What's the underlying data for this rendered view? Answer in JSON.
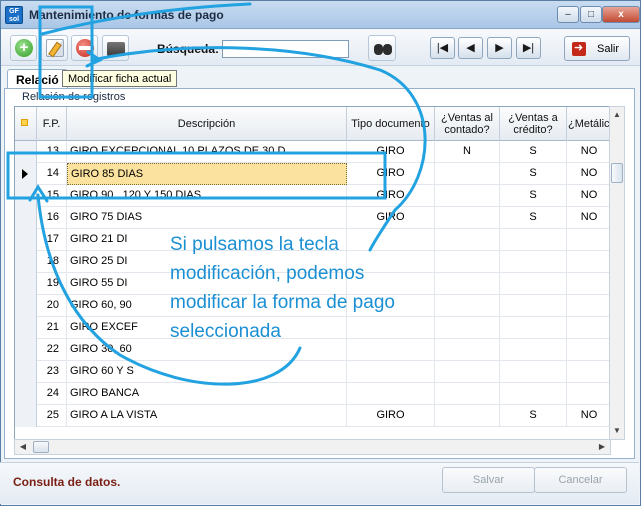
{
  "window": {
    "app_icon": "GF sol",
    "title": "Mantenimiento de formas de pago",
    "controls": {
      "minimize": "–",
      "maximize": "□",
      "close": "x"
    }
  },
  "toolbar": {
    "buttons": [
      {
        "name": "add",
        "icon": "add-icon"
      },
      {
        "name": "edit",
        "icon": "edit-icon"
      },
      {
        "name": "delete",
        "icon": "delete-icon"
      },
      {
        "name": "print",
        "icon": "print-icon"
      }
    ],
    "search_label": "Búsqueda:",
    "search_value": "",
    "search_icon": "binoculars-icon",
    "nav": {
      "first": "|◀",
      "prev": "◀",
      "next": "▶",
      "last": "▶|"
    },
    "exit_label": "Salir"
  },
  "tooltip": "Modificar ficha actual",
  "tab": {
    "label": "Relació"
  },
  "group_label": "Relación de registros",
  "table": {
    "columns": [
      "F.P.",
      "Descripción",
      "Tipo documento",
      "¿Ventas al contado?",
      "¿Ventas a crédito?",
      "¿Metálico?"
    ],
    "header_marker_icon": "select-all-icon",
    "selected_row_index": 1,
    "rows": [
      {
        "fp": "13",
        "desc": "GIRO EXCEPCIONAL 10 PLAZOS DE 30 D",
        "tipo": "GIRO",
        "contado": "N",
        "credito": "S",
        "metalico": "NO"
      },
      {
        "fp": "14",
        "desc": "GIRO  85 DIAS",
        "tipo": "GIRO",
        "contado": "",
        "credito": "S",
        "metalico": "NO"
      },
      {
        "fp": "15",
        "desc": "GIRO 90 , 120 Y 150 DIAS",
        "tipo": "GIRO",
        "contado": "",
        "credito": "S",
        "metalico": "NO"
      },
      {
        "fp": "16",
        "desc": "GIRO  75 DIAS",
        "tipo": "GIRO",
        "contado": "",
        "credito": "S",
        "metalico": "NO"
      },
      {
        "fp": "17",
        "desc": "GIRO  21 DI",
        "tipo": "",
        "contado": "",
        "credito": "",
        "metalico": ""
      },
      {
        "fp": "18",
        "desc": "GIRO  25 DI",
        "tipo": "",
        "contado": "",
        "credito": "",
        "metalico": ""
      },
      {
        "fp": "19",
        "desc": "GIRO  55 DI",
        "tipo": "",
        "contado": "",
        "credito": "",
        "metalico": ""
      },
      {
        "fp": "20",
        "desc": "GIRO 60, 90",
        "tipo": "",
        "contado": "",
        "credito": "",
        "metalico": ""
      },
      {
        "fp": "21",
        "desc": "GIRO EXCEF",
        "tipo": "",
        "contado": "",
        "credito": "",
        "metalico": ""
      },
      {
        "fp": "22",
        "desc": "GIRO 30, 60",
        "tipo": "",
        "contado": "",
        "credito": "",
        "metalico": ""
      },
      {
        "fp": "23",
        "desc": "GIRO 60 Y S",
        "tipo": "",
        "contado": "",
        "credito": "",
        "metalico": ""
      },
      {
        "fp": "24",
        "desc": "GIRO BANCA",
        "tipo": "",
        "contado": "",
        "credito": "",
        "metalico": ""
      },
      {
        "fp": "25",
        "desc": "GIRO A LA VISTA",
        "tipo": "GIRO",
        "contado": "",
        "credito": "S",
        "metalico": "NO"
      }
    ]
  },
  "scroll_arrows": {
    "up": "▲",
    "down": "▼",
    "left": "◀",
    "right": "▶"
  },
  "status": {
    "text": "Consulta de datos."
  },
  "footer": {
    "save_label": "Salvar",
    "cancel_label": "Cancelar"
  },
  "annotation": {
    "text": "Si pulsamos la tecla modificación, podemos modificar la forma de pago seleccionada",
    "color": "#1a8fd3"
  }
}
